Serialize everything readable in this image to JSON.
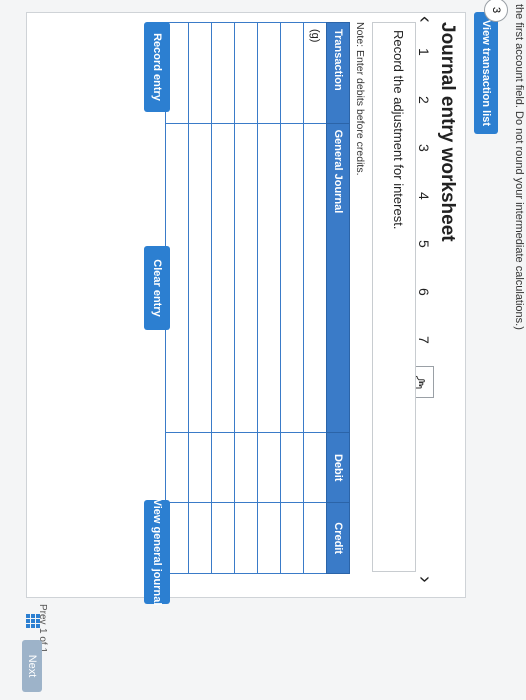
{
  "header": {
    "truncated_note": "the first account field. Do not round your intermediate calculations.)"
  },
  "buttons": {
    "view_transaction_list": "View transaction list",
    "record_entry": "Record entry",
    "clear_entry": "Clear entry",
    "view_general_journal": "View general journal"
  },
  "worksheet": {
    "title": "Journal entry worksheet",
    "nav_numbers": [
      "1",
      "2",
      "3",
      "4",
      "5",
      "6",
      "7"
    ],
    "instruction": "Record the adjustment for interest.",
    "note": "Note: Enter debits before credits."
  },
  "table": {
    "headers": {
      "transaction": "Transaction",
      "account": "General Journal",
      "debit": "Debit",
      "credit": "Credit"
    },
    "rows": [
      {
        "transaction": "(g)"
      },
      {
        "transaction": ""
      },
      {
        "transaction": ""
      },
      {
        "transaction": ""
      },
      {
        "transaction": ""
      },
      {
        "transaction": ""
      },
      {
        "transaction": ""
      }
    ]
  },
  "footer": {
    "pager": "1 of 1",
    "prev": "Prev",
    "next": "Next",
    "side_page": "3"
  },
  "colors": {
    "accent": "#2c7fd1",
    "table_header": "#3a7bc8"
  }
}
